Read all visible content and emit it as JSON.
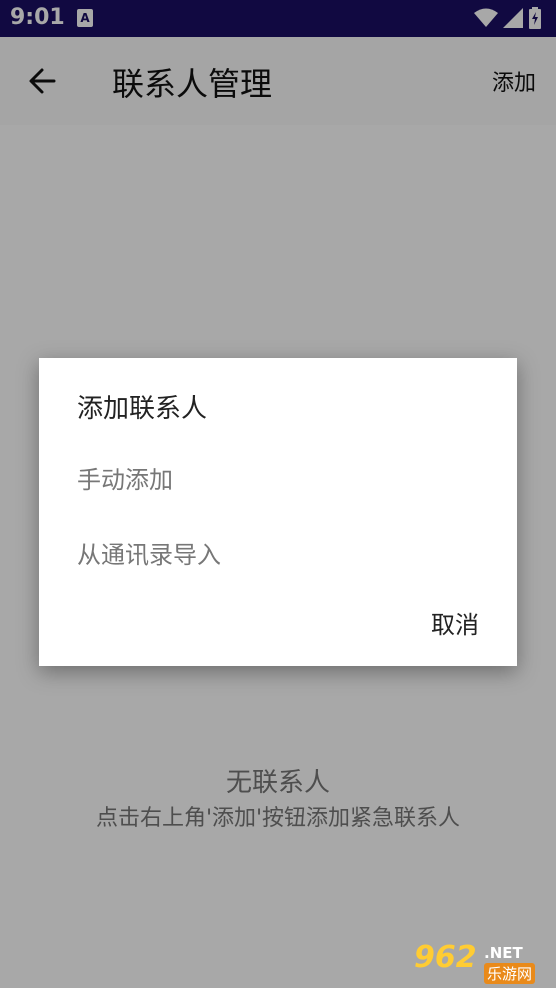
{
  "status_bar": {
    "time": "9:01",
    "notification_letter": "A",
    "icons": [
      "wifi-icon",
      "signal-icon",
      "battery-icon"
    ]
  },
  "app_bar": {
    "title": "联系人管理",
    "back_icon": "arrow-left-icon",
    "add_label": "添加"
  },
  "empty_state": {
    "title": "无联系人",
    "hint": "点击右上角'添加'按钮添加紧急联系人"
  },
  "dialog": {
    "title": "添加联系人",
    "options": [
      "手动添加",
      "从通讯录导入"
    ],
    "cancel_label": "取消"
  },
  "watermark": {
    "number": "962",
    "domain": ".NET",
    "site": "乐游网"
  },
  "colors": {
    "status_bar": "#1a0e63",
    "scrim": "rgba(0,0,0,0.34)"
  }
}
